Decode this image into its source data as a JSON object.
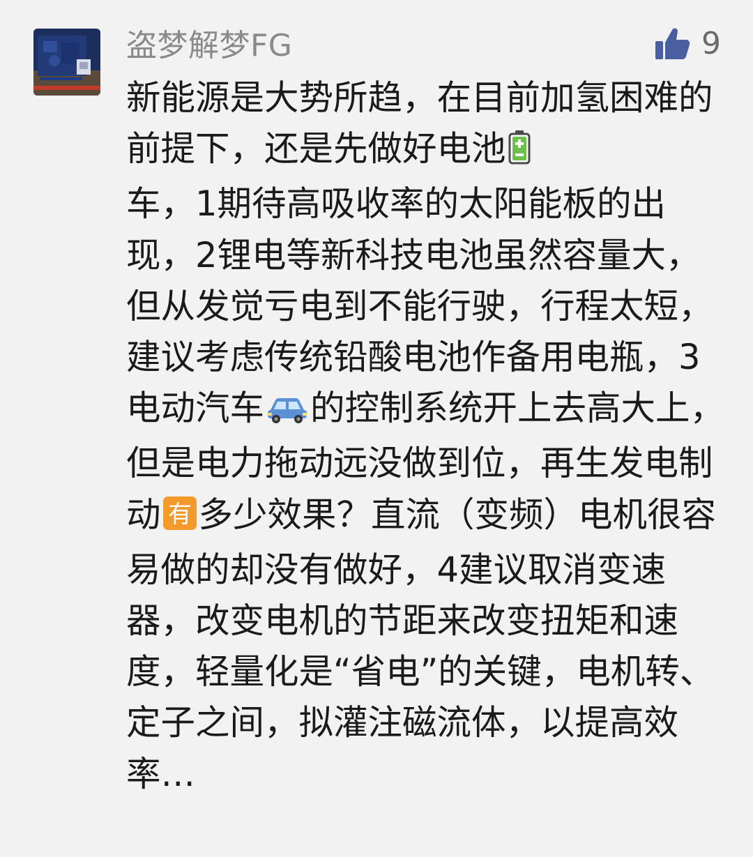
{
  "comment": {
    "username": "盗梦解梦FG",
    "likes": "9",
    "text_segments": [
      "新能源是大势所趋，在目前加氢困难的前提下，还是先做好电池",
      "车，1期待高吸收率的太阳能板的出现，2锂电等新科技电池虽然容量大，但从发觉亏电到不能行驶，行程太短，建议考虑传统铅酸电池作备用电瓶，3电动汽车",
      "的控制系统开上去高大上，但是电力拖动远没做到位，再生发电制动",
      "多少效果？直流（变频）电机很容易做的却没有做好，4建议取消变速器，改变电机的节距来改变扭矩和速度，轻量化是“省电”的关键，电机转、定子之间，拟灌注磁流体，以提高效率…"
    ],
    "emojis": {
      "battery": {
        "icon": "battery-emoji",
        "color": "#6cc04a"
      },
      "car": {
        "icon": "car-emoji",
        "color": "#5b8fd6"
      },
      "have": {
        "icon": "have-emoji",
        "label": "有",
        "color": "#f39a2b"
      }
    }
  },
  "colors": {
    "background": "#f2f2f2",
    "username": "#8a8a8a",
    "text": "#1a1a1a",
    "like_icon": "#4a5fa0"
  }
}
